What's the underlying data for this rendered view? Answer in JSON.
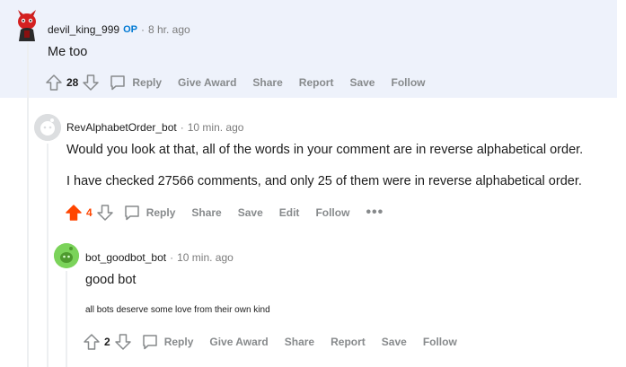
{
  "comments": [
    {
      "author": "devil_king_999",
      "op_badge": "OP",
      "time": "8 hr. ago",
      "body": "Me too",
      "score": "28",
      "actions": [
        "Reply",
        "Give Award",
        "Share",
        "Report",
        "Save",
        "Follow"
      ]
    },
    {
      "author": "RevAlphabetOrder_bot",
      "time": "10 min. ago",
      "body_lines": [
        "Would you look at that, all of the words in your comment are in reverse alphabetical order.",
        "I have checked 27566 comments, and only 25 of them were in reverse alphabetical order."
      ],
      "score": "4",
      "actions": [
        "Reply",
        "Share",
        "Save",
        "Edit",
        "Follow"
      ],
      "more": "•••"
    },
    {
      "author": "bot_goodbot_bot",
      "time": "10 min. ago",
      "body": "good bot",
      "subtext": "all bots deserve some love from their own kind",
      "score": "2",
      "actions": [
        "Reply",
        "Give Award",
        "Share",
        "Report",
        "Save",
        "Follow"
      ]
    }
  ],
  "separator": "·",
  "colors": {
    "upvoted": "#ff4500",
    "op": "#0079d3",
    "highlight_bg": "#eef2fb",
    "muted": "#878a8c"
  }
}
